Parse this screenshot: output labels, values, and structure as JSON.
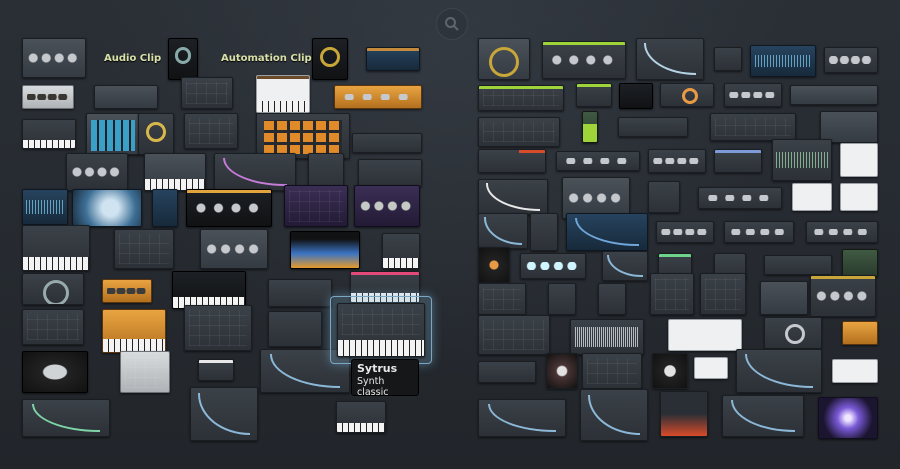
{
  "labels": {
    "audio_clip": "Audio Clip",
    "automation_clip": "Automation Clip"
  },
  "tooltip": {
    "title": "Sytrus",
    "subtitle": "Synth classic"
  },
  "colors": {
    "background": "#262b31",
    "accent_green": "#9fd33a",
    "label_text": "#d9e0a8",
    "highlight": "#7aa7c4"
  },
  "icons": {
    "search": "search-icon"
  }
}
